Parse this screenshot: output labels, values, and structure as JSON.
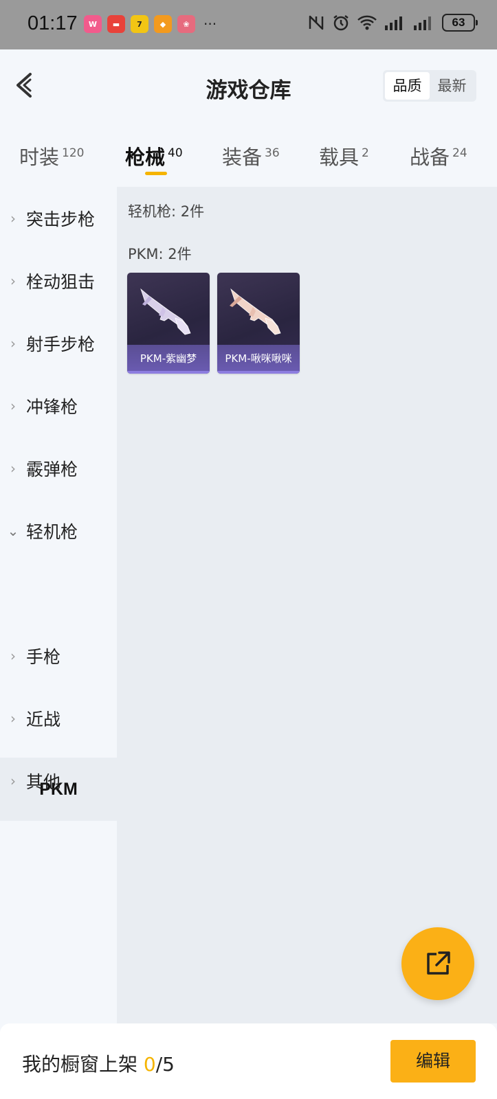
{
  "status_bar": {
    "time": "01:17",
    "battery": "63",
    "more": "···",
    "apps": [
      {
        "name": "weibo-app-icon",
        "label": "W",
        "color": "#f25b8c"
      },
      {
        "name": "red-app-icon",
        "label": "▬",
        "color": "#e8423a"
      },
      {
        "name": "seven-app-icon",
        "label": "7",
        "color": "#f2c514"
      },
      {
        "name": "orange-app-icon",
        "label": "◆",
        "color": "#f39a1e"
      },
      {
        "name": "game-app-icon",
        "label": "❀",
        "color": "#e66b7e"
      }
    ]
  },
  "header": {
    "title": "游戏仓库",
    "sort_options": [
      "品质",
      "最新"
    ],
    "sort_selected": "品质"
  },
  "tabs": [
    {
      "label": "时装",
      "count": "120"
    },
    {
      "label": "枪械",
      "count": "40",
      "active": true
    },
    {
      "label": "装备",
      "count": "36"
    },
    {
      "label": "载具",
      "count": "2"
    },
    {
      "label": "战备",
      "count": "24"
    }
  ],
  "sidebar": {
    "items": [
      {
        "label": "突击步枪"
      },
      {
        "label": "栓动狙击"
      },
      {
        "label": "射手步枪"
      },
      {
        "label": "冲锋枪"
      },
      {
        "label": "霰弹枪"
      },
      {
        "label": "轻机枪",
        "expanded": true
      },
      {
        "label": "手枪"
      },
      {
        "label": "近战"
      },
      {
        "label": "其他"
      }
    ],
    "sub_item": "PKM"
  },
  "content": {
    "section_title": "轻机枪: 2件",
    "group_title": "PKM: 2件",
    "items": [
      {
        "name": "PKM-紫幽梦",
        "tint": "#d9d0ea"
      },
      {
        "name": "PKM-啾咪啾咪",
        "tint": "#f1d4c8"
      }
    ]
  },
  "bottom": {
    "label": "我的橱窗上架 ",
    "count": "0",
    "total": "/5",
    "edit_label": "编辑"
  },
  "colors": {
    "accent": "#f5b400",
    "card_bg": "#2f2844",
    "card_label": "#6b5cb3"
  }
}
